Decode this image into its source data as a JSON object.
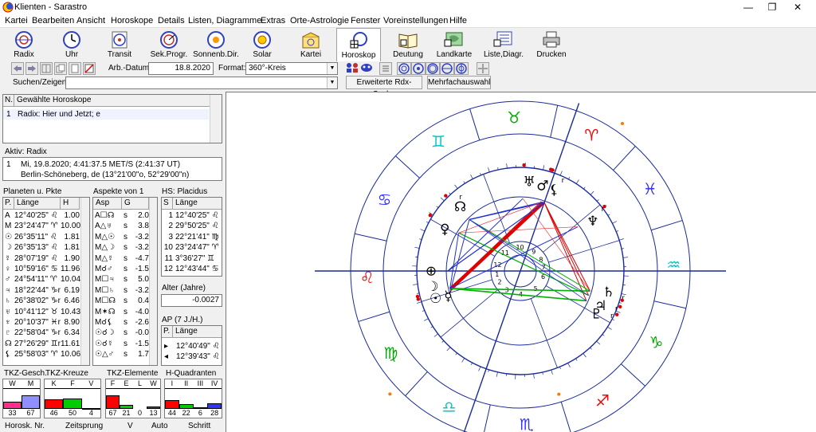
{
  "window": {
    "title": "Klienten - Sarastro",
    "controls": {
      "minimize": "—",
      "maximize": "❐",
      "close": "✕"
    }
  },
  "menu": [
    "Kartei",
    "Bearbeiten",
    "Ansicht",
    "Horoskope",
    "Details",
    "Listen, Diagramme",
    "Extras",
    "Orte-Astrologie",
    "Fenster",
    "Voreinstellungen",
    "Hilfe"
  ],
  "toolbar": [
    {
      "label": "Radix",
      "icon": "radix-icon"
    },
    {
      "label": "Uhr",
      "icon": "clock-chart-icon"
    },
    {
      "label": "Transit",
      "icon": "transit-icon"
    },
    {
      "label": "Sek.Progr.",
      "icon": "progression-icon"
    },
    {
      "label": "Sonnenb.Dir.",
      "icon": "solar-arc-icon"
    },
    {
      "label": "Solar",
      "icon": "solar-return-icon"
    },
    {
      "label": "Kartei",
      "icon": "card-index-icon"
    },
    {
      "label": "Horoskop",
      "icon": "horoscope-icon"
    },
    {
      "label": "Deutung",
      "icon": "interpretation-book-icon"
    },
    {
      "label": "Landkarte",
      "icon": "map-icon"
    },
    {
      "label": "Liste,Diagr.",
      "icon": "list-diagram-icon"
    },
    {
      "label": "Drucken",
      "icon": "printer-icon"
    }
  ],
  "row2": {
    "arb_datum_label": "Arb.-Datum:",
    "arb_datum_value": "18.8.2020",
    "format_label": "Format:",
    "format_value": "360°-Kreis"
  },
  "row3": {
    "search_label": "Suchen/Zeigen:",
    "search_value": "",
    "extended_search": "Erweiterte Rdx-Suche",
    "multi_select": "Mehrfachauswahl"
  },
  "horoscope_list": {
    "headers": [
      "N.",
      "Gewählte Horoskope"
    ],
    "rows": [
      [
        "1",
        "Radix: Hier und Jetzt; e"
      ]
    ]
  },
  "active": {
    "label": "Aktiv: Radix",
    "index": "1",
    "line1": "Mi, 19.8.2020; 4:41:37.5 MET/S (2:41:37 UT)",
    "line2": "Berlin-Schöneberg, de (13°21'00\"o, 52°29'00\"n)"
  },
  "planets": {
    "title": "Planeten u. Pkte",
    "headers": [
      "P.",
      "Länge",
      "H"
    ],
    "rows": [
      [
        "A",
        "12°40'25\" ♌",
        "1.00"
      ],
      [
        "M",
        "23°24'47\" ♈",
        "10.00"
      ],
      [
        "☉",
        "26°35'11\" ♌",
        "1.81"
      ],
      [
        "☽",
        "26°35'13\" ♌",
        "1.81"
      ],
      [
        "☿",
        "28°07'19\" ♌",
        "1.90"
      ],
      [
        "♀",
        "10°59'16\" ♋",
        "11.96"
      ],
      [
        "♂",
        "24°54'11\" ♈",
        "10.04"
      ],
      [
        "♃",
        "18°22'44\" ♑r",
        "6.19"
      ],
      [
        "♄",
        "26°38'02\" ♑r",
        "6.46"
      ],
      [
        "♅",
        "10°41'12\" ♉",
        "10.43"
      ],
      [
        "♆",
        "20°10'37\" ♓r",
        "8.90"
      ],
      [
        "♇",
        "22°58'04\" ♑r",
        "6.34"
      ],
      [
        "☊",
        "27°26'29\" ♊r",
        "11.61"
      ],
      [
        "⚸",
        "25°58'03\" ♈",
        "10.06"
      ]
    ]
  },
  "aspects": {
    "title": "Aspekte von 1",
    "headers": [
      "Asp",
      "G"
    ],
    "rows": [
      [
        "A☐☊",
        "s",
        "2.0"
      ],
      [
        "A△♅",
        "s",
        "3.8"
      ],
      [
        "M△☉",
        "s",
        "-3.2"
      ],
      [
        "M△☽",
        "s",
        "-3.2"
      ],
      [
        "M△☿",
        "s",
        "-4.7"
      ],
      [
        "M☌♂",
        "s",
        "-1.5"
      ],
      [
        "M☐♃",
        "s",
        "5.0"
      ],
      [
        "M☐♄",
        "s",
        "-3.2"
      ],
      [
        "M☐☊",
        "s",
        "0.4"
      ],
      [
        "M✶☊",
        "s",
        "-4.0"
      ],
      [
        "M☌⚸",
        "s",
        "-2.6"
      ],
      [
        "☉☌☽",
        "s",
        "-0.0"
      ],
      [
        "☉☌☿",
        "s",
        "-1.5"
      ],
      [
        "☉△♂",
        "s",
        "1.7"
      ]
    ]
  },
  "houses": {
    "title": "HS: Placidus",
    "headers": [
      "S",
      "Länge"
    ],
    "rows": [
      [
        "1",
        "12°40'25\" ♌"
      ],
      [
        "2",
        "29°50'25\" ♌"
      ],
      [
        "3",
        "22°21'41\" ♍"
      ],
      [
        "10",
        "23°24'47\" ♈"
      ],
      [
        "11",
        "3°36'27\" ♊"
      ],
      [
        "12",
        "12°43'44\" ♋"
      ]
    ]
  },
  "alter": {
    "label": "Alter (Jahre)",
    "value": "-0.0027"
  },
  "ap": {
    "label": "AP (7 J./H.)",
    "headers": [
      "P.",
      "Länge"
    ],
    "rows": [
      [
        "▸",
        "12°40'49\" ♌"
      ],
      [
        "◂",
        "12°39'43\" ♌"
      ]
    ]
  },
  "tkz": [
    {
      "title": "TKZ-Gesch.",
      "headers": [
        "W",
        "M"
      ],
      "values": [
        33,
        67
      ],
      "colors": [
        "#ff2d8c",
        "#8f8fff"
      ]
    },
    {
      "title": "TKZ-Kreuze",
      "headers": [
        "K",
        "F",
        "V"
      ],
      "values": [
        46,
        50,
        4
      ],
      "colors": [
        "#ff0000",
        "#00cc00",
        "#3333ff"
      ]
    },
    {
      "title": "TKZ-Elemente",
      "headers": [
        "F",
        "E",
        "L",
        "W"
      ],
      "values": [
        67,
        21,
        0,
        13
      ],
      "colors": [
        "#ff0000",
        "#00cc00",
        "#ffff00",
        "#3333ff"
      ]
    },
    {
      "title": "H-Quadranten  %",
      "headers": [
        "I",
        "II",
        "III",
        "IV"
      ],
      "values": [
        44,
        22,
        6,
        28
      ],
      "colors": [
        "#ff0000",
        "#00cc00",
        "#ffff00",
        "#3333ff"
      ]
    }
  ],
  "bottom": {
    "horosk_nr": "Horosk. Nr.",
    "zeitsprung": "Zeitsprung",
    "v": "V",
    "auto": "Auto",
    "schritt": "Schritt"
  },
  "chart": {
    "zodiac_glyphs": [
      "♈",
      "♉",
      "♊",
      "♋",
      "♌",
      "♍",
      "♎",
      "♏",
      "♐",
      "♑",
      "♒",
      "♓"
    ],
    "zodiac_colors": [
      "#ff0000",
      "#00aa00",
      "#00c8c8",
      "#3333ff",
      "#ff0000",
      "#00aa00",
      "#00c8c8",
      "#3333ff",
      "#ff0000",
      "#00aa00",
      "#00c8c8",
      "#3333ff"
    ],
    "house_numbers": [
      "1",
      "2",
      "3",
      "4",
      "5",
      "6",
      "7",
      "8",
      "9",
      "10",
      "11",
      "12"
    ],
    "planet_marks": [
      {
        "glyph": "☉",
        "name": "sun"
      },
      {
        "glyph": "☽",
        "name": "moon"
      },
      {
        "glyph": "☿",
        "name": "mercury"
      },
      {
        "glyph": "♀",
        "name": "venus"
      },
      {
        "glyph": "♂",
        "name": "mars"
      },
      {
        "glyph": "♃",
        "name": "jupiter"
      },
      {
        "glyph": "♄",
        "name": "saturn"
      },
      {
        "glyph": "♅",
        "name": "uranus"
      },
      {
        "glyph": "♆",
        "name": "neptune"
      },
      {
        "glyph": "♇",
        "name": "pluto"
      },
      {
        "glyph": "☊",
        "name": "node"
      },
      {
        "glyph": "⚸",
        "name": "lilith"
      },
      {
        "glyph": "⊕",
        "name": "part-of-fortune"
      }
    ],
    "retro": "r"
  }
}
